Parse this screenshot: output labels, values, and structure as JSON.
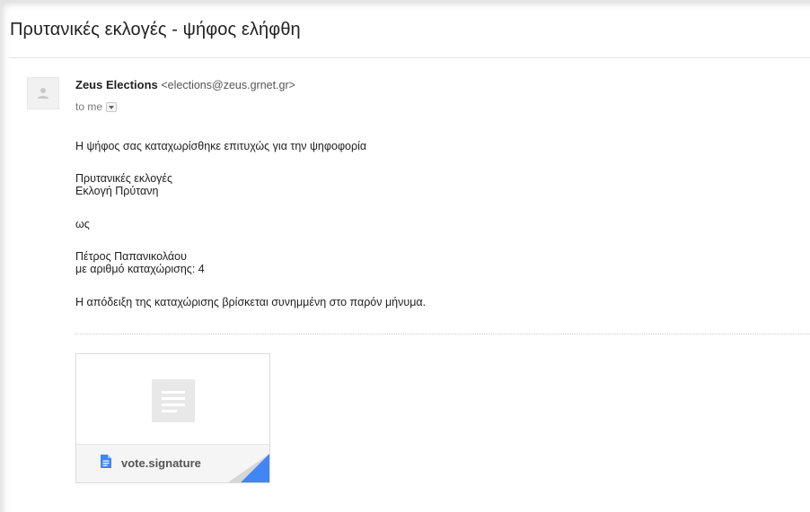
{
  "email": {
    "subject": "Πρυτανικές εκλογές - ψήφος ελήφθη",
    "sender_name": "Zeus Elections",
    "sender_address": "<elections@zeus.grnet.gr>",
    "recipient": "to me",
    "body": {
      "line1": "Η ψήφος σας καταχωρίσθηκε επιτυχώς για την ψηφοφορία",
      "election_name": "Πρυτανικές εκλογές",
      "poll_name": "Εκλογή Πρύτανη",
      "as_label": "ως",
      "voter_name": "Πέτρος Παπανικολάου",
      "registration": "με αριθμό καταχώρισης: 4",
      "receipt_note": "Η απόδειξη της καταχώρισης βρίσκεται συνημμένη στο παρόν μήνυμα."
    },
    "attachment": {
      "file_name": "vote.signature",
      "icon": "document-icon"
    }
  },
  "colors": {
    "attachment_corner": "#4285f4",
    "attachment_icon": "#4285f4"
  }
}
